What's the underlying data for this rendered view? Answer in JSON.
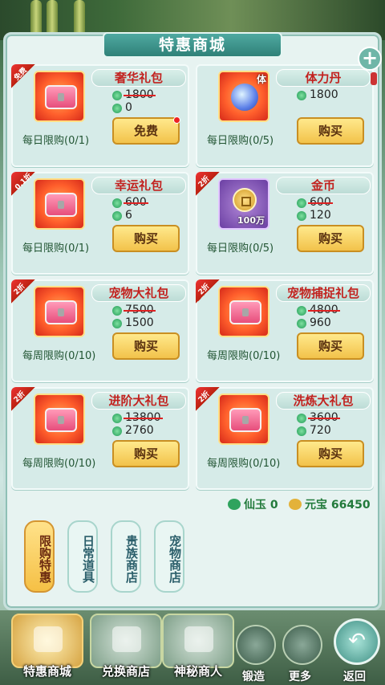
{
  "title": "特惠商城",
  "close_icon": "+",
  "cards": [
    {
      "badge": "免费",
      "name": "奢华礼包",
      "old_price": "1800",
      "new_price": "0",
      "button": "免费",
      "limit": "每日限购(0/1)",
      "icon": "chest",
      "dot": true
    },
    {
      "badge": "",
      "name": "体力丹",
      "old_price": "",
      "new_price": "1800",
      "button": "购买",
      "limit": "每日限购(0/5)",
      "icon": "orb",
      "icon_label": "体"
    },
    {
      "badge": "0.1折",
      "name": "幸运礼包",
      "old_price": "600",
      "new_price": "6",
      "button": "购买",
      "limit": "每日限购(0/1)",
      "icon": "chest"
    },
    {
      "badge": "2折",
      "name": "金币",
      "old_price": "600",
      "new_price": "120",
      "button": "购买",
      "limit": "每日限购(0/5)",
      "icon": "coin",
      "qty": "100万"
    },
    {
      "badge": "2折",
      "name": "宠物大礼包",
      "old_price": "7500",
      "new_price": "1500",
      "button": "购买",
      "limit": "每周限购(0/10)",
      "icon": "chest"
    },
    {
      "badge": "2折",
      "name": "宠物捕捉礼包",
      "old_price": "4800",
      "new_price": "960",
      "button": "购买",
      "limit": "每周限购(0/10)",
      "icon": "chest"
    },
    {
      "badge": "2折",
      "name": "进阶大礼包",
      "old_price": "13800",
      "new_price": "2760",
      "button": "购买",
      "limit": "每周限购(0/10)",
      "icon": "chest"
    },
    {
      "badge": "2折",
      "name": "洗炼大礼包",
      "old_price": "3600",
      "new_price": "720",
      "button": "购买",
      "limit": "每周限购(0/10)",
      "icon": "chest"
    }
  ],
  "currency": {
    "xianyu_label": "仙玉",
    "xianyu_value": "0",
    "yuanbao_label": "元宝",
    "yuanbao_value": "66450"
  },
  "side_tabs": [
    "限购特惠",
    "日常道具",
    "贵族商店",
    "宠物商店"
  ],
  "bottom": {
    "b1": "特惠商城",
    "b2": "兑换商店",
    "b3": "神秘商人",
    "s1": "锻造",
    "s2": "更多",
    "back": "返回"
  },
  "colors": {
    "accent": "#2f8178",
    "price_red": "#c2221f",
    "button_gold": "#f2c24a"
  }
}
